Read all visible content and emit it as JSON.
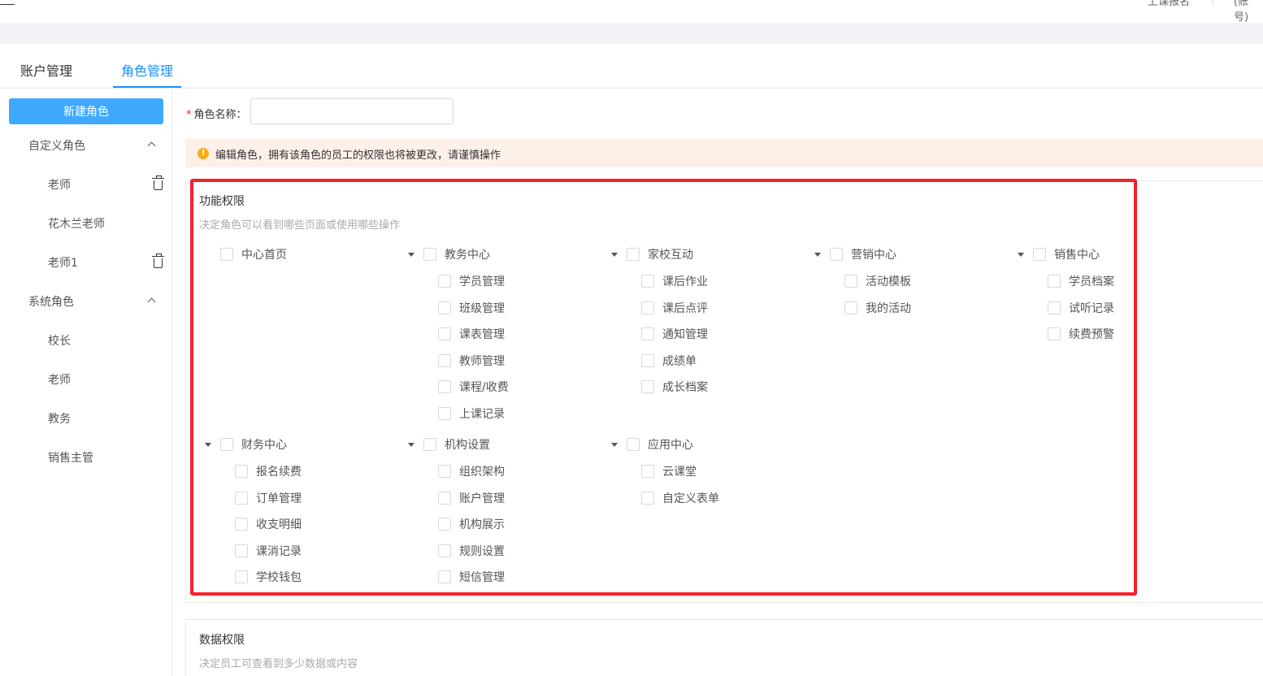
{
  "topbar": {
    "link_1": "上课报名",
    "link_2": "(账号)"
  },
  "tabs": [
    {
      "label": "账户管理",
      "active": false
    },
    {
      "label": "角色管理",
      "active": true
    }
  ],
  "sidebar": {
    "new_role_label": "新建角色",
    "custom_group": {
      "title": "自定义角色",
      "items": [
        {
          "label": "老师",
          "deletable": true
        },
        {
          "label": "花木兰老师",
          "deletable": false
        },
        {
          "label": "老师1",
          "deletable": true
        }
      ]
    },
    "system_group": {
      "title": "系统角色",
      "items": [
        {
          "label": "校长"
        },
        {
          "label": "老师"
        },
        {
          "label": "教务"
        },
        {
          "label": "销售主管"
        }
      ]
    }
  },
  "form": {
    "required_mark": "*",
    "role_name_label": "角色名称：",
    "role_name_value": "",
    "role_name_placeholder": ""
  },
  "warning": {
    "icon": "exclamation-circle-icon",
    "text": "编辑角色，拥有该角色的员工的权限也将被更改，请谨慎操作",
    "color": "#faad14"
  },
  "function_permissions": {
    "title": "功能权限",
    "description": "决定角色可以看到哪些页面或使用哪些操作",
    "groups": [
      {
        "label": "中心首页",
        "children": []
      },
      {
        "label": "教务中心",
        "children": [
          "学员管理",
          "班级管理",
          "课表管理",
          "教师管理",
          "课程/收费",
          "上课记录"
        ]
      },
      {
        "label": "家校互动",
        "children": [
          "课后作业",
          "课后点评",
          "通知管理",
          "成绩单",
          "成长档案"
        ]
      },
      {
        "label": "营销中心",
        "children": [
          "活动模板",
          "我的活动"
        ]
      },
      {
        "label": "销售中心",
        "children": [
          "学员档案",
          "试听记录",
          "续费预警"
        ]
      },
      {
        "label": "财务中心",
        "children": [
          "报名续费",
          "订单管理",
          "收支明细",
          "课消记录",
          "学校钱包"
        ]
      },
      {
        "label": "机构设置",
        "children": [
          "组织架构",
          "账户管理",
          "机构展示",
          "规则设置",
          "短信管理"
        ]
      },
      {
        "label": "应用中心",
        "children": [
          "云课堂",
          "自定义表单"
        ]
      }
    ]
  },
  "data_permissions": {
    "title": "数据权限",
    "description": "决定员工可查看到多少数据或内容"
  },
  "colors": {
    "primary": "#1890ff",
    "button": "#40a9ff",
    "highlight": "#f5222d",
    "warning_bg": "#fdf0e9"
  }
}
